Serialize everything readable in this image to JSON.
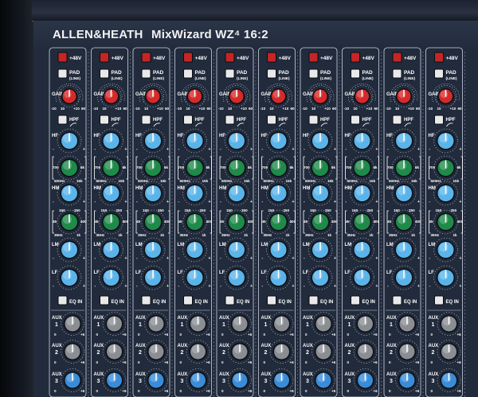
{
  "console": {
    "brand": "ALLEN&HEATH",
    "model": "MixWizard WZ⁴ 16:2"
  },
  "strip_labels": {
    "phantom": "+48V",
    "pad": "PAD",
    "pad_sub": "(LINE)",
    "gain": "GAIN",
    "gain_scale_low": "-10",
    "gain_scale_mid": "10",
    "gain_scale_high": "+10",
    "gain_scale_max": "60",
    "hpf": "HPF",
    "hf": "HF",
    "hm": "HM",
    "lm": "LM",
    "lf": "LF",
    "eq_in": "EQ IN",
    "hm_freq_low": "500Hz",
    "hm_freq_high": "15k",
    "hm_freq_mid_l": "700",
    "hm_freq_mid_r": "6k",
    "lm_freq_low": "35Hz",
    "lm_freq_high": "1k",
    "lm_freq_mid_l": "45",
    "lm_freq_mid_r": "400",
    "lm_freq_top_l": "150",
    "lm_freq_top_r": "250",
    "aux": "AUX",
    "aux_numbers": [
      "1",
      "2",
      "3"
    ]
  },
  "channel_count_visible": 10,
  "colors": {
    "panel": "#212b3c",
    "gain_knob": "#d42a2a",
    "eq_gain_knob": "#5ab4ea",
    "eq_freq_knob": "#1f8a4a",
    "aux_knob_grey": "#8a8d92",
    "aux_knob_blue": "#3a8cd8",
    "phantom_button": "#c42525",
    "switch_button": "#e9e9e9"
  }
}
